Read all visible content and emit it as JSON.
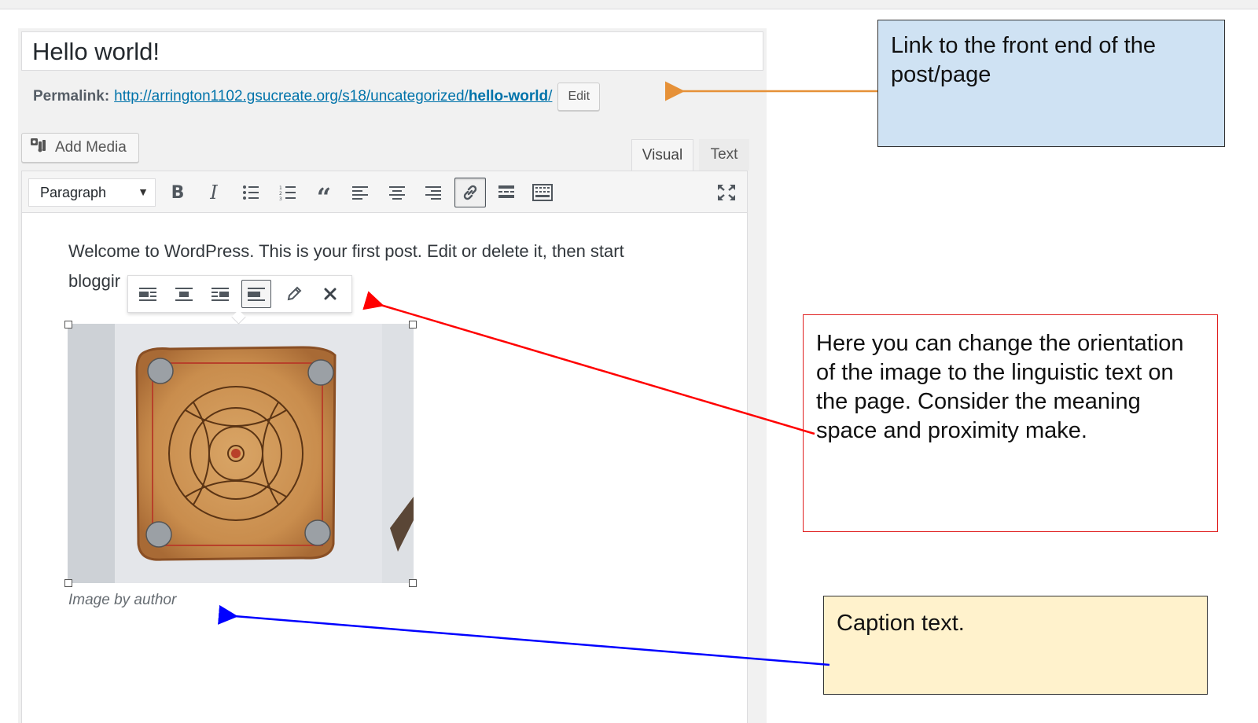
{
  "post": {
    "title": "Hello world!",
    "permalink_label": "Permalink:",
    "permalink_base": "http://arrington1102.gsucreate.org/s18/uncategorized/",
    "permalink_slug": "hello-world",
    "permalink_trail": "/",
    "edit_label": "Edit"
  },
  "editor": {
    "add_media_label": "Add Media",
    "tabs": {
      "visual": "Visual",
      "text": "Text"
    },
    "format_value": "Paragraph",
    "toolbar_icons": [
      "bold-icon",
      "italic-icon",
      "bulleted-list-icon",
      "numbered-list-icon",
      "blockquote-icon",
      "align-left-icon",
      "align-center-icon",
      "align-right-icon",
      "link-icon",
      "read-more-icon",
      "toolbar-toggle-icon",
      "fullscreen-icon"
    ],
    "paragraph_line1": "Welcome to WordPress. This is your first post. Edit or delete it, then start",
    "paragraph_line2": "bloggir",
    "image_toolbar_icons": [
      "align-left-icon",
      "align-center-icon",
      "align-right-icon",
      "no-align-icon",
      "pencil-edit-icon",
      "remove-icon"
    ],
    "caption": "Image by author"
  },
  "annotations": {
    "permalink_note": "Link to the front end of the post/page",
    "orientation_note": "Here you can change the orientation of the image to the linguistic text on the page. Consider the meaning space and proximity make.",
    "caption_note": "Caption text.",
    "colors": {
      "orange": "#e69138",
      "red": "#ff0000",
      "blue": "#0000ff",
      "blue_fill": "#cfe2f3",
      "yellow_fill": "#fff2cc"
    }
  }
}
